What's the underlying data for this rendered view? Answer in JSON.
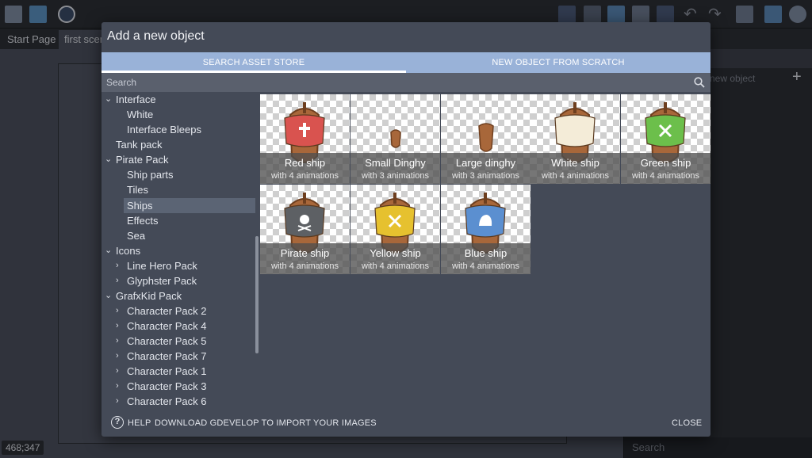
{
  "app": {
    "tabs": [
      {
        "label": "Start Page"
      },
      {
        "label": "first scene"
      }
    ],
    "coordinates": "468;347",
    "objects_panel": {
      "new_object_label": "new object",
      "search_placeholder": "Search"
    }
  },
  "dialog": {
    "title": "Add a new object",
    "tabs": [
      {
        "label": "SEARCH ASSET STORE",
        "active": true
      },
      {
        "label": "NEW OBJECT FROM SCRATCH",
        "active": false
      }
    ],
    "search": {
      "placeholder": "Search",
      "value": ""
    },
    "tree": [
      {
        "label": "Interface",
        "expanded": true,
        "level": 0
      },
      {
        "label": "White",
        "level": 1
      },
      {
        "label": "Interface Bleeps",
        "level": 1
      },
      {
        "label": "Tank pack",
        "level": 0
      },
      {
        "label": "Pirate Pack",
        "expanded": true,
        "level": 0
      },
      {
        "label": "Ship parts",
        "level": 1
      },
      {
        "label": "Tiles",
        "level": 1
      },
      {
        "label": "Ships",
        "level": 1,
        "selected": true
      },
      {
        "label": "Effects",
        "level": 1
      },
      {
        "label": "Sea",
        "level": 1
      },
      {
        "label": "Icons",
        "expanded": true,
        "level": 0
      },
      {
        "label": "Line Hero Pack",
        "expanded": false,
        "level": 1
      },
      {
        "label": "Glyphster Pack",
        "expanded": false,
        "level": 1
      },
      {
        "label": "GrafxKid Pack",
        "expanded": true,
        "level": 0
      },
      {
        "label": "Character Pack 2",
        "expanded": false,
        "level": 1
      },
      {
        "label": "Character Pack 4",
        "expanded": false,
        "level": 1
      },
      {
        "label": "Character Pack 5",
        "expanded": false,
        "level": 1
      },
      {
        "label": "Character Pack 7",
        "expanded": false,
        "level": 1
      },
      {
        "label": "Character Pack 1",
        "expanded": false,
        "level": 1
      },
      {
        "label": "Character Pack 3",
        "expanded": false,
        "level": 1
      },
      {
        "label": "Character Pack 6",
        "expanded": false,
        "level": 1
      }
    ],
    "assets": [
      {
        "name": "Red ship",
        "subtitle": "with 4 animations",
        "sail_color": "#d9534f",
        "emblem": "cross",
        "size": "large"
      },
      {
        "name": "Small Dinghy",
        "subtitle": "with 3 animations",
        "size": "small"
      },
      {
        "name": "Large dinghy",
        "subtitle": "with 3 animations",
        "size": "medium"
      },
      {
        "name": "White ship",
        "subtitle": "with 4 animations",
        "sail_color": "#f4ecd8",
        "emblem": "none",
        "size": "large"
      },
      {
        "name": "Green ship",
        "subtitle": "with 4 animations",
        "sail_color": "#6cbf4b",
        "emblem": "swords",
        "size": "large"
      },
      {
        "name": "Pirate ship",
        "subtitle": "with 4 animations",
        "sail_color": "#5d6064",
        "emblem": "skull",
        "size": "large"
      },
      {
        "name": "Yellow ship",
        "subtitle": "with 4 animations",
        "sail_color": "#e6c12f",
        "emblem": "swords",
        "size": "large"
      },
      {
        "name": "Blue ship",
        "subtitle": "with 4 animations",
        "sail_color": "#5b8fd0",
        "emblem": "helmet",
        "size": "large"
      }
    ],
    "footer": {
      "help_label": "HELP",
      "download_label": "DOWNLOAD GDEVELOP TO IMPORT YOUR IMAGES",
      "close_label": "CLOSE"
    }
  }
}
